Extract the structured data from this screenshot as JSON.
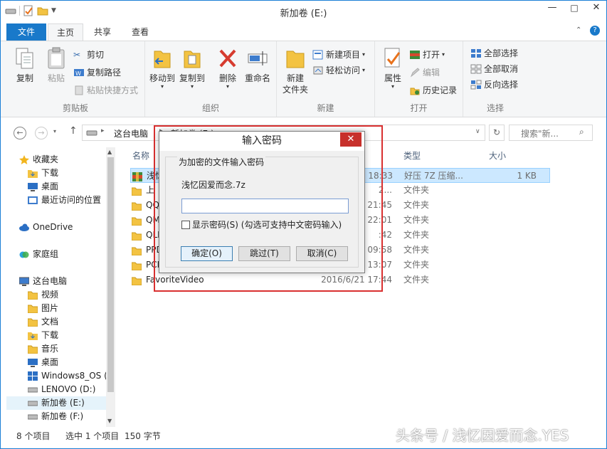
{
  "window": {
    "title": "新加卷 (E:)",
    "min": "—",
    "max": "□",
    "close": "✕"
  },
  "tabs": {
    "file": "文件",
    "home": "主页",
    "share": "共享",
    "view": "查看"
  },
  "ribbon": {
    "clipboard": {
      "label": "剪贴板",
      "copy": "复制",
      "paste": "粘贴",
      "cut": "剪切",
      "copy_path": "复制路径",
      "paste_shortcut": "粘贴快捷方式"
    },
    "organize": {
      "label": "组织",
      "move_to": "移动到",
      "copy_to": "复制到",
      "delete": "删除",
      "rename": "重命名"
    },
    "new": {
      "label": "新建",
      "new_folder_line1": "新建",
      "new_folder_line2": "文件夹",
      "new_item": "新建项目",
      "easy_access": "轻松访问"
    },
    "open": {
      "label": "打开",
      "properties": "属性",
      "open": "打开",
      "edit": "编辑",
      "history": "历史记录"
    },
    "select": {
      "label": "选择",
      "select_all": "全部选择",
      "select_none": "全部取消",
      "invert": "反向选择"
    }
  },
  "address": {
    "crumbs": [
      "这台电脑",
      "新加卷 (E:)"
    ],
    "search_placeholder": "搜索\"新..."
  },
  "nav": [
    {
      "label": "收藏夹",
      "icon": "star-icon",
      "indent": 0
    },
    {
      "label": "下载",
      "icon": "folder-download-icon",
      "indent": 1
    },
    {
      "label": "桌面",
      "icon": "desktop-icon",
      "indent": 1
    },
    {
      "label": "最近访问的位置",
      "icon": "recent-icon",
      "indent": 1
    },
    {
      "label": "OneDrive",
      "icon": "cloud-icon",
      "indent": 0
    },
    {
      "label": "家庭组",
      "icon": "homegroup-icon",
      "indent": 0
    },
    {
      "label": "这台电脑",
      "icon": "computer-icon",
      "indent": 0
    },
    {
      "label": "视频",
      "icon": "folder-icon",
      "indent": 1
    },
    {
      "label": "图片",
      "icon": "folder-icon",
      "indent": 1
    },
    {
      "label": "文档",
      "icon": "folder-icon",
      "indent": 1
    },
    {
      "label": "下载",
      "icon": "folder-download-icon",
      "indent": 1
    },
    {
      "label": "音乐",
      "icon": "folder-icon",
      "indent": 1
    },
    {
      "label": "桌面",
      "icon": "desktop-icon",
      "indent": 1
    },
    {
      "label": "Windows8_OS (",
      "icon": "windows-drive-icon",
      "indent": 1
    },
    {
      "label": "LENOVO (D:)",
      "icon": "drive-icon",
      "indent": 1
    },
    {
      "label": "新加卷 (E:)",
      "icon": "drive-icon",
      "indent": 1,
      "selected": true
    },
    {
      "label": "新加卷 (F:)",
      "icon": "drive-icon",
      "indent": 1
    }
  ],
  "columns": {
    "name": "名称",
    "type": "类型",
    "size": "大小"
  },
  "files": [
    {
      "name": "浅忆",
      "date": "18:33",
      "type": "好压 7Z 压缩...",
      "size": "1 KB",
      "icon": "archive-icon"
    },
    {
      "name": "上",
      "date": "2...",
      "type": "文件夹",
      "size": "",
      "icon": "folder-icon"
    },
    {
      "name": "QQM",
      "date": "21:45",
      "type": "文件夹",
      "size": "",
      "icon": "folder-icon"
    },
    {
      "name": "QMD",
      "date": "22:01",
      "type": "文件夹",
      "size": "",
      "icon": "folder-icon"
    },
    {
      "name": "QLD",
      "date": ":42",
      "type": "文件夹",
      "size": "",
      "icon": "folder-icon"
    },
    {
      "name": "PPD",
      "date": "09:58",
      "type": "文件夹",
      "size": "",
      "icon": "folder-icon"
    },
    {
      "name": "PCM",
      "date": "13:07",
      "type": "文件夹",
      "size": "",
      "icon": "folder-icon"
    },
    {
      "name": "FavoriteVideo",
      "date": "2016/6/21 17:44",
      "type": "文件夹",
      "size": "",
      "icon": "folder-icon"
    }
  ],
  "status": {
    "count": "8 个项目",
    "selected": "选中 1 个项目",
    "bytes": "150 字节"
  },
  "dialog": {
    "title": "输入密码",
    "group": "为加密的文件输入密码",
    "filename": "浅忆因爱而念.7z",
    "password_value": "",
    "show_password": "显示密码(S) (勾选可支持中文密码输入)",
    "ok": "确定(O)",
    "skip": "跳过(T)",
    "cancel": "取消(C)"
  },
  "watermark": "头条号 / 浅忆因爱而念.YES",
  "colors": {
    "accent": "#1979ca",
    "highlight": "#d93030",
    "dialog_close": "#c7302b"
  }
}
